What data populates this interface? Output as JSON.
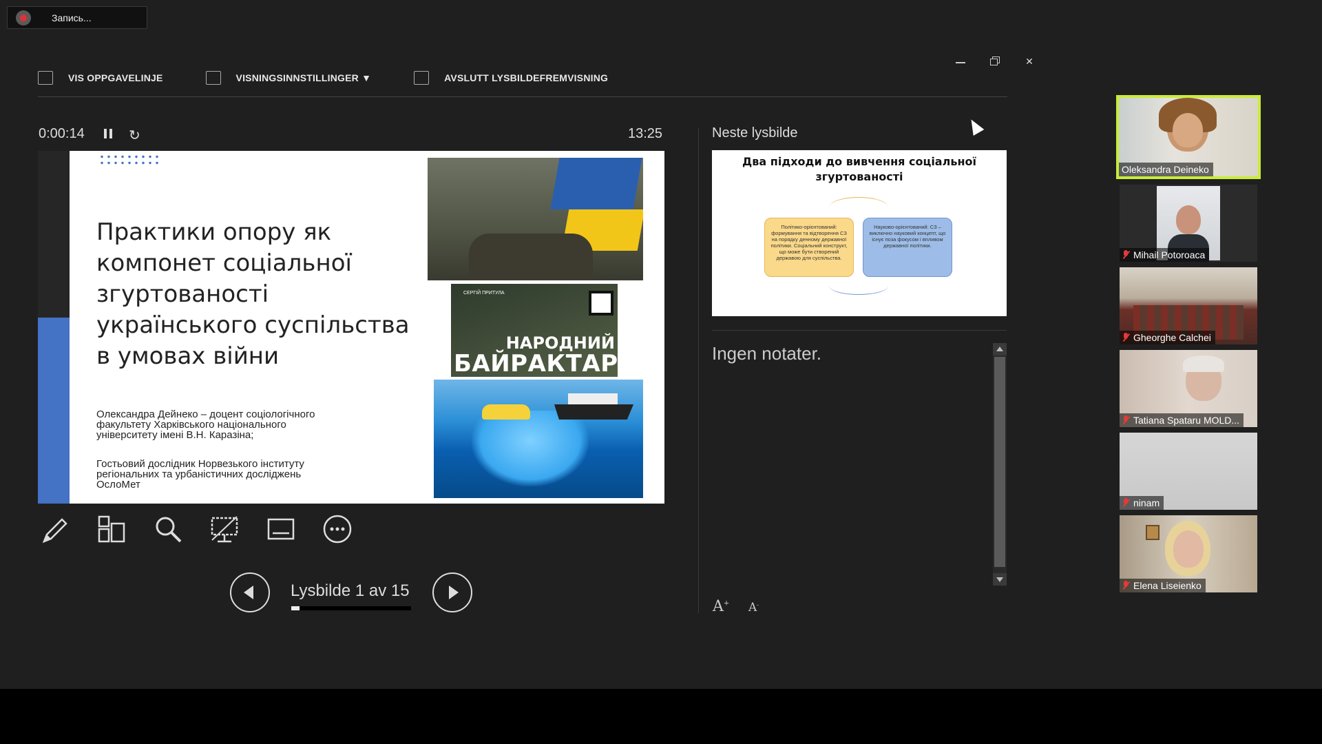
{
  "recording": {
    "label": "Запись..."
  },
  "toolbar": {
    "show_taskbar": "VIS OPPGAVELINJE",
    "display_settings": "VISNINGSINNSTILLINGER ▼",
    "end_slideshow": "AVSLUTT LYSBILDEFREMVISNING"
  },
  "timer": {
    "elapsed": "0:00:14",
    "clock": "13:25"
  },
  "current_slide": {
    "title": "Практики опору як компонет соціальної згуртованості українського суспільства в умовах війни",
    "author": "Олександра Дейнеко – доцент соціологічного факультету Харківського національного університету імені В.Н. Каразіна;",
    "guest": "Гостьовий дослідник Норвезького інституту регіональних та урбаністичних досліджень ОслоМет",
    "image2_line1": "НАРОДНИЙ",
    "image2_line2": "БАЙРАКТАР",
    "image2_small": "СЕРГІЙ ПРИТУЛА"
  },
  "navigation": {
    "counter": "Lysbilde 1 av 15",
    "progress_fraction": 0.067
  },
  "next_slide": {
    "label": "Neste lysbilde",
    "title": "Два підходи до вивчення соціальної згуртованості",
    "box1": "Політико-орієнтований: формування та відтворення СЗ на порядку денному державної політики. Соціальний конструкт, що може бути створений державою для суспільства.",
    "box2": "Науково-орієнтований: СЗ – виключно науковий концепт, що існує поза фокусом і впливом державної політики."
  },
  "notes": {
    "text": "Ingen notater."
  },
  "participants": [
    {
      "name": "Oleksandra Deineko",
      "muted": false,
      "active": true
    },
    {
      "name": "Mihail Potoroaca",
      "muted": true,
      "active": false
    },
    {
      "name": "Gheorghe Calchei",
      "muted": true,
      "active": false
    },
    {
      "name": "Tatiana Spataru  MOLD...",
      "muted": true,
      "active": false
    },
    {
      "name": "ninam",
      "muted": true,
      "active": false
    },
    {
      "name": "Elena Liseienko",
      "muted": true,
      "active": false
    }
  ],
  "colors": {
    "accent_blue": "#4472c4",
    "active_speaker": "#c9ec3a",
    "muted_red": "#e23a3a"
  }
}
